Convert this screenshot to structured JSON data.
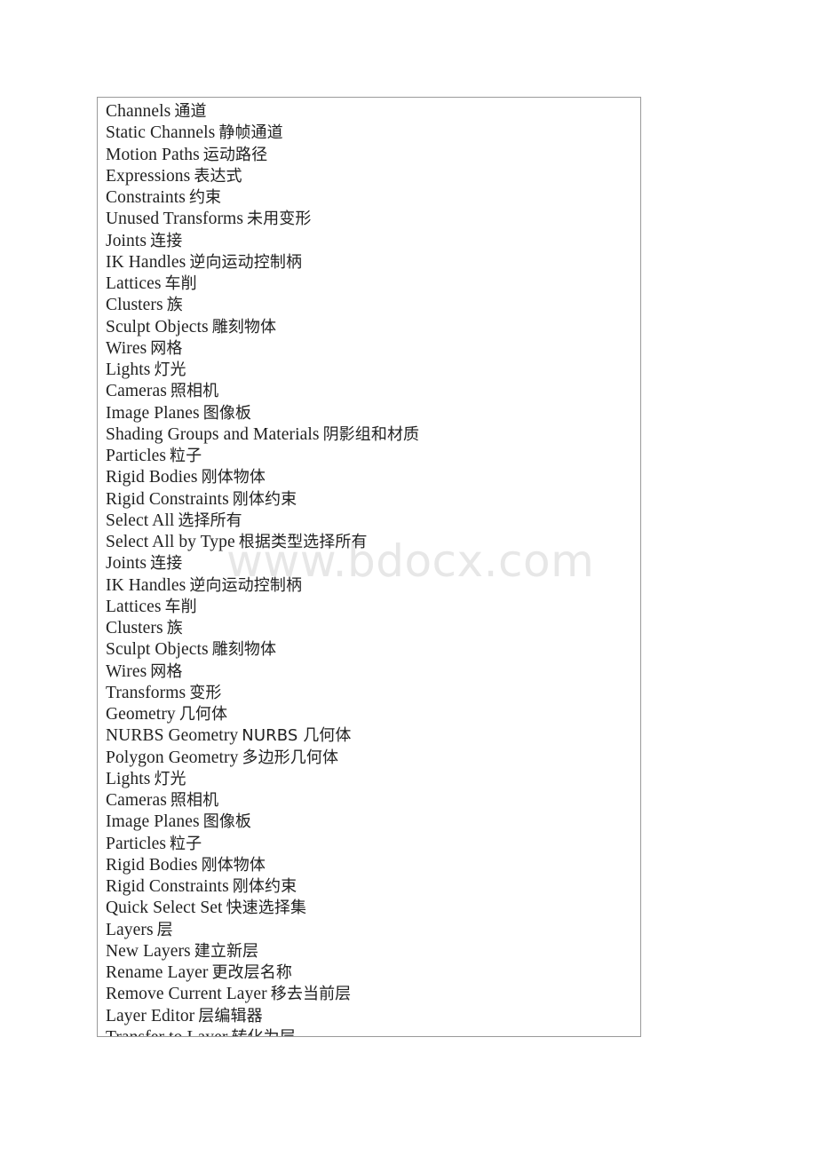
{
  "page": {
    "background_color": "#ffffff",
    "border_color": "#9a9a9a",
    "text_color": "#222222"
  },
  "watermark": {
    "text": "www.bdocx.com",
    "color": "#e7e7e7"
  },
  "glossary": {
    "entries": [
      {
        "term": "Channels",
        "gloss": "通道"
      },
      {
        "term": "Static Channels",
        "gloss": "静帧通道"
      },
      {
        "term": "Motion Paths",
        "gloss": "运动路径"
      },
      {
        "term": "Expressions",
        "gloss": "表达式"
      },
      {
        "term": "Constraints",
        "gloss": "约束"
      },
      {
        "term": "Unused Transforms",
        "gloss": "未用变形"
      },
      {
        "term": "Joints",
        "gloss": "连接"
      },
      {
        "term": "IK Handles",
        "gloss": "逆向运动控制柄"
      },
      {
        "term": "Lattices",
        "gloss": "车削"
      },
      {
        "term": "Clusters",
        "gloss": "族"
      },
      {
        "term": "Sculpt Objects",
        "gloss": "雕刻物体"
      },
      {
        "term": "Wires",
        "gloss": "网格"
      },
      {
        "term": "Lights",
        "gloss": "灯光"
      },
      {
        "term": "Cameras",
        "gloss": "照相机"
      },
      {
        "term": "Image Planes",
        "gloss": "图像板"
      },
      {
        "term": "Shading Groups and Materials",
        "gloss": "阴影组和材质"
      },
      {
        "term": "Particles",
        "gloss": "粒子"
      },
      {
        "term": "Rigid Bodies",
        "gloss": "刚体物体"
      },
      {
        "term": "Rigid Constraints",
        "gloss": "刚体约束"
      },
      {
        "term": "Select All",
        "gloss": "选择所有"
      },
      {
        "term": "Select All by Type",
        "gloss": "根据类型选择所有"
      },
      {
        "term": "Joints",
        "gloss": "连接"
      },
      {
        "term": "IK Handles",
        "gloss": "逆向运动控制柄"
      },
      {
        "term": "Lattices",
        "gloss": "车削"
      },
      {
        "term": "Clusters",
        "gloss": "族"
      },
      {
        "term": "Sculpt Objects",
        "gloss": "雕刻物体"
      },
      {
        "term": "Wires",
        "gloss": "网格"
      },
      {
        "term": "Transforms",
        "gloss": "变形"
      },
      {
        "term": "Geometry",
        "gloss": "几何体"
      },
      {
        "term": "NURBS Geometry",
        "gloss": "NURBS 几何体"
      },
      {
        "term": "Polygon Geometry",
        "gloss": "多边形几何体"
      },
      {
        "term": "Lights",
        "gloss": "灯光"
      },
      {
        "term": "Cameras",
        "gloss": "照相机"
      },
      {
        "term": "Image Planes",
        "gloss": "图像板"
      },
      {
        "term": "Particles",
        "gloss": "粒子"
      },
      {
        "term": "Rigid Bodies",
        "gloss": "刚体物体"
      },
      {
        "term": "Rigid Constraints",
        "gloss": "刚体约束"
      },
      {
        "term": "Quick Select Set",
        "gloss": "快速选择集"
      },
      {
        "term": "Layers",
        "gloss": "层"
      },
      {
        "term": "New Layers",
        "gloss": "建立新层"
      },
      {
        "term": "Rename Layer",
        "gloss": "更改层名称"
      },
      {
        "term": "Remove Current Layer",
        "gloss": "移去当前层"
      },
      {
        "term": "Layer Editor",
        "gloss": "层编辑器"
      },
      {
        "term": "Transfer to Layer",
        "gloss": "转化为层"
      }
    ]
  }
}
